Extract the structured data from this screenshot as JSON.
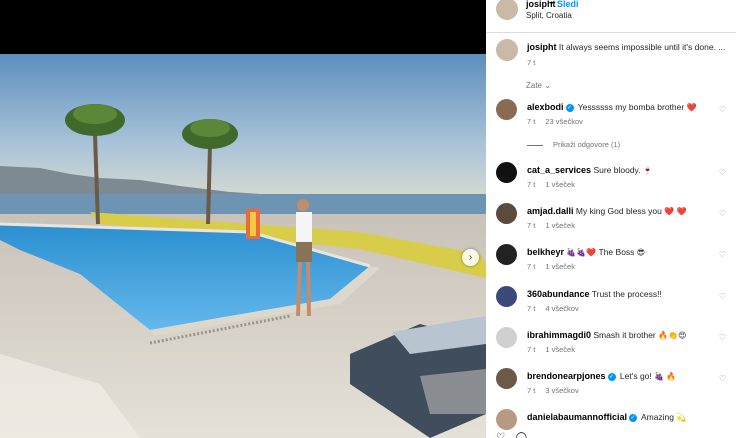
{
  "post": {
    "username": "josipht",
    "follow_label": "Sledi",
    "separator": "•",
    "location": "Split, Croatia",
    "caption_text": "It always seems impossible until it's done. ...",
    "caption_time": "7 t",
    "translate_label": "Zate"
  },
  "comments": [
    {
      "user": "alexbodi",
      "verified": true,
      "text": "Yessssss my bomba brother",
      "emoji": "❤️",
      "time": "7 t",
      "likes": "23 všečkov",
      "avatar_color": "#8a6b52"
    },
    {
      "user": "cat_a_services",
      "verified": false,
      "text": "Sure bloody.",
      "emoji": "🍷",
      "time": "7 t",
      "likes": "1 všeček",
      "avatar_color": "#111111"
    },
    {
      "user": "amjad.dalli",
      "verified": false,
      "text": "My king God bless you",
      "emoji": "❤️ ❤️",
      "time": "7 t",
      "likes": "1 všeček",
      "avatar_color": "#5b4a3e"
    },
    {
      "user": "belkheyr",
      "verified": false,
      "text": "The Boss",
      "emoji": "🍇🍇❤️",
      "emoji2": "😎",
      "time": "7 t",
      "likes": "1 všeček",
      "avatar_color": "#222222"
    },
    {
      "user": "360abundance",
      "verified": false,
      "text": "Trust the process!!",
      "emoji": "",
      "time": "7 t",
      "likes": "4 všečkov",
      "avatar_color": "#3a4a7a"
    },
    {
      "user": "ibrahimmagdi0",
      "verified": false,
      "text": "Smash it brother",
      "emoji": "🔥👏😍",
      "time": "7 t",
      "likes": "1 všeček",
      "avatar_color": "#d0d0d0"
    },
    {
      "user": "brendonearpjones",
      "verified": true,
      "text": "Let's go!",
      "emoji": "🍇 🔥",
      "time": "7 t",
      "likes": "3 všečkov",
      "avatar_color": "#6b5a48"
    },
    {
      "user": "danielabaumannofficial",
      "verified": true,
      "text": "Amazing",
      "emoji": "💫",
      "time": "",
      "likes": "",
      "avatar_color": "#b89a82"
    }
  ],
  "replies_label": "Prikaži odgovore (1)"
}
